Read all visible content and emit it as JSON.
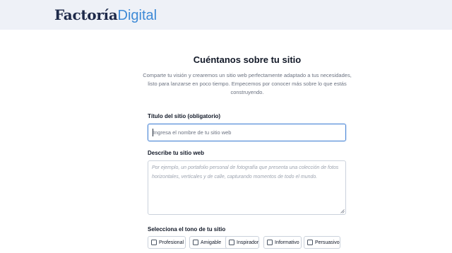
{
  "brand": {
    "name_part1": "Factoría",
    "name_part2": "Digital",
    "colors": {
      "dark": "#1e2a4a",
      "accent": "#3e8ad6"
    }
  },
  "intro": {
    "title": "Cuéntanos sobre tu sitio",
    "description": "Comparte tu visión y crearemos un sitio web perfectamente adaptado a tus necesidades, listo para lanzarse en poco tiempo. Empecemos por conocer más sobre lo que estás construyendo."
  },
  "form": {
    "site_title": {
      "label": "Título del sitio (obligatorio)",
      "value": "",
      "placeholder": "Ingresa el nombre de tu sitio web"
    },
    "site_description": {
      "label": "Describe tu sitio web",
      "value": "",
      "placeholder": "Por ejemplo, un portafolio personal de fotografía que presenta una colección de fotos horizontales, verticales y de calle, capturando momentos de todo el mundo."
    },
    "tone": {
      "label": "Selecciona el tono de tu sitio",
      "options": [
        {
          "label": "Profesional",
          "checked": false
        },
        {
          "label": "Amigable",
          "checked": false
        },
        {
          "label": "Inspirador",
          "checked": false
        },
        {
          "label": "Informativo",
          "checked": false
        },
        {
          "label": "Persuasivo",
          "checked": false
        }
      ]
    }
  }
}
